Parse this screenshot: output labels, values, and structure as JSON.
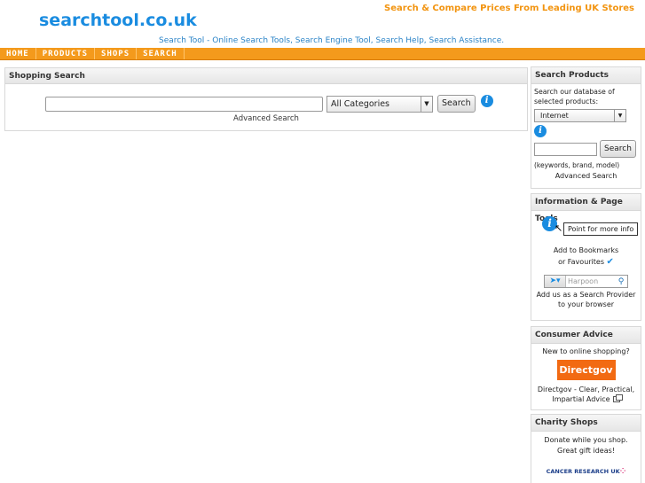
{
  "header": {
    "logo": "searchtool.co.uk",
    "tagline": "Search & Compare Prices From Leading UK Stores",
    "subtitle": "Search Tool - Online Search Tools, Search Engine Tool, Search Help, Search Assistance."
  },
  "nav": {
    "items": [
      "HOME",
      "PRODUCTS",
      "SHOPS",
      "SEARCH"
    ]
  },
  "shopping_search": {
    "title": "Shopping Search",
    "input_value": "",
    "category_selected": "All Categories",
    "search_button": "Search",
    "advanced_link": "Advanced Search"
  },
  "sidebar": {
    "search_products": {
      "title": "Search Products",
      "description": "Search our database of selected products:",
      "category_selected": "Internet",
      "search_button": "Search",
      "hint": "(keywords, brand, model)",
      "advanced_link": "Advanced Search"
    },
    "info_tools": {
      "title": "Information & Page Tools",
      "tooltip": "Point for more info",
      "bookmark_line1": "Add to Bookmarks",
      "bookmark_line2": "or Favourites",
      "harpoon_placeholder": "Harpoon",
      "provider_line1": "Add us as a Search Provider",
      "provider_line2": "to your browser"
    },
    "consumer_advice": {
      "title": "Consumer Advice",
      "question": "New to online shopping?",
      "logo_text": "Directgov",
      "line1": "Directgov - Clear, Practical,",
      "line2": "Impartial Advice"
    },
    "charity_shops": {
      "title": "Charity Shops",
      "line1": "Donate while you shop.",
      "line2": "Great gift ideas!",
      "logo_text": "CANCER RESEARCH UK"
    }
  },
  "colors": {
    "brand_blue": "#1a8ce0",
    "nav_orange": "#f49a1c",
    "directgov_orange": "#f26a12"
  }
}
